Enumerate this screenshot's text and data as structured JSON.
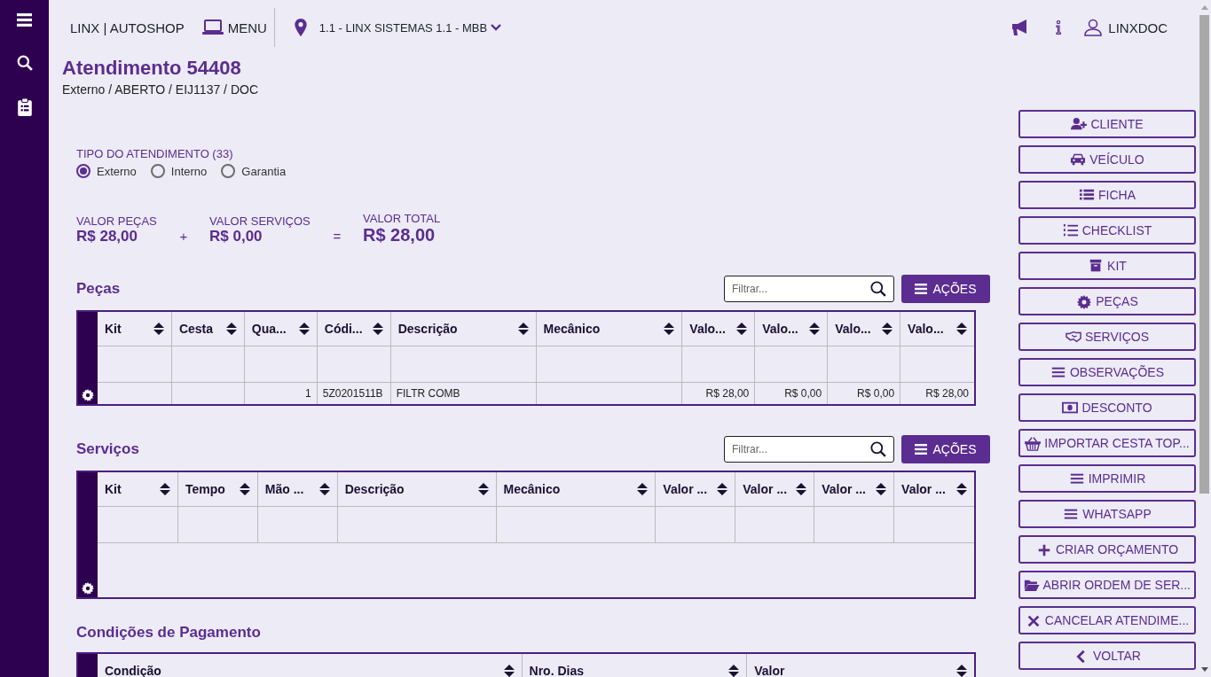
{
  "topbar": {
    "brand": "LINX | AUTOSHOP",
    "menu": "MENU",
    "location": "1.1 - LINX SISTEMAS 1.1 - MBB",
    "user": "LINXDOC"
  },
  "header": {
    "title": "Atendimento 54408",
    "subtitle": "Externo / ABERTO / EIJ1137 /  DOC"
  },
  "tipo": {
    "label": "TIPO DO ATENDIMENTO (33)",
    "options": [
      {
        "label": "Externo",
        "selected": true
      },
      {
        "label": "Interno",
        "selected": false
      },
      {
        "label": "Garantia",
        "selected": false
      }
    ]
  },
  "totals": [
    {
      "label": "VALOR PEÇAS",
      "value": "R$ 28,00",
      "kind": "part"
    },
    {
      "operator": "+",
      "kind": "op"
    },
    {
      "label": "VALOR SERVIÇOS",
      "value": "R$ 0,00",
      "kind": "part"
    },
    {
      "operator": "=",
      "kind": "op"
    },
    {
      "label": "VALOR TOTAL",
      "value": "R$ 28,00",
      "kind": "total"
    }
  ],
  "sections": [
    {
      "title": "Peças",
      "filter": {
        "placeholder": "Filtrar..."
      },
      "actions": "AÇÕES",
      "columns": [
        {
          "label": "Kit",
          "kind": "text"
        },
        {
          "label": "Cesta",
          "kind": "text"
        },
        {
          "label": "Qua...",
          "kind": "number"
        },
        {
          "label": "Códi...",
          "kind": "text"
        },
        {
          "label": "Descrição",
          "kind": "text"
        },
        {
          "label": "Mecânico",
          "kind": "text"
        },
        {
          "label": "Valo...",
          "kind": "number"
        },
        {
          "label": "Valo...",
          "kind": "number"
        },
        {
          "label": "Valo...",
          "kind": "number"
        },
        {
          "label": "Valo...",
          "kind": "number"
        }
      ],
      "rows": [
        [
          "",
          "",
          "1",
          "5Z0201511B",
          "FILTR COMB",
          "",
          "R$ 28,00",
          "R$ 0,00",
          "R$ 0,00",
          "R$ 28,00"
        ]
      ]
    },
    {
      "title": "Serviços",
      "filter": {
        "placeholder": "Filtrar..."
      },
      "actions": "AÇÕES",
      "columns": [
        {
          "label": "Kit"
        },
        {
          "label": "Tempo"
        },
        {
          "label": "Mão ..."
        },
        {
          "label": "Descrição"
        },
        {
          "label": "Mecânico"
        },
        {
          "label": "Valor ..."
        },
        {
          "label": "Valor ..."
        },
        {
          "label": "Valor ..."
        },
        {
          "label": "Valor ..."
        }
      ]
    }
  ],
  "payment": {
    "title": "Condições de Pagamento",
    "columns": [
      {
        "label": "Condição"
      },
      {
        "label": "Nro. Dias"
      },
      {
        "label": "Valor"
      }
    ]
  },
  "actions": [
    "CLIENTE",
    "VEÍCULO",
    "FICHA",
    "CHECKLIST",
    "KIT",
    "PEÇAS",
    "SERVIÇOS",
    "OBSERVAÇÕES",
    "DESCONTO",
    "IMPORTAR CESTA TOP...",
    "IMPRIMIR",
    "WHATSAPP",
    "CRIAR ORÇAMENTO",
    "ABRIR ORDEM DE SER...",
    "CANCELAR ATENDIME...",
    "VOLTAR"
  ]
}
